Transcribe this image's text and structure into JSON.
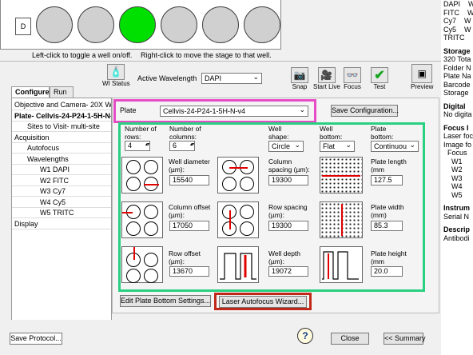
{
  "plate_preview": {
    "row_label": "D",
    "left_hint": "Left-click to toggle a well on/off.",
    "right_hint": "Right-click to move the stage to that well."
  },
  "right_pane": {
    "lines": [
      {
        "text": "DAPI    W",
        "bold": false
      },
      {
        "text": "FITC    W",
        "bold": false
      },
      {
        "text": "Cy7    W",
        "bold": false
      },
      {
        "text": "Cy5    W",
        "bold": false
      },
      {
        "text": "TRITC",
        "bold": false
      },
      {
        "text": "Storage",
        "bold": true
      },
      {
        "text": "320 Tota",
        "bold": false
      },
      {
        "text": "Folder N",
        "bold": false
      },
      {
        "text": "Plate Na",
        "bold": false
      },
      {
        "text": "Barcode",
        "bold": false
      },
      {
        "text": "Storage",
        "bold": false
      },
      {
        "text": "Digital",
        "bold": true
      },
      {
        "text": "No digita",
        "bold": false
      },
      {
        "text": "Focus I",
        "bold": true
      },
      {
        "text": "Laser foc",
        "bold": false
      },
      {
        "text": "Image fo",
        "bold": false
      },
      {
        "text": "  Focus",
        "bold": false
      },
      {
        "text": "    W1",
        "bold": false
      },
      {
        "text": "    W2",
        "bold": false
      },
      {
        "text": "    W3",
        "bold": false
      },
      {
        "text": "    W4",
        "bold": false
      },
      {
        "text": "    W5",
        "bold": false
      },
      {
        "text": "Instrum",
        "bold": true
      },
      {
        "text": "Serial N",
        "bold": false
      },
      {
        "text": "Descrip",
        "bold": true
      },
      {
        "text": "Antibodi",
        "bold": false
      }
    ]
  },
  "toolbar": {
    "wi_status": "WI Status",
    "active_wavelength_label": "Active Wavelength",
    "active_wavelength_value": "DAPI",
    "snap": "Snap",
    "start_live": "Start Live",
    "focus": "Focus",
    "test": "Test",
    "preview": "Preview"
  },
  "tabs": [
    "Configure",
    "Run"
  ],
  "tree": [
    {
      "label": "Objective and Camera- 20X Wa",
      "indent": 0,
      "bold": false
    },
    {
      "label": "Plate- Cellvis-24-P24-1-5H-N-",
      "indent": 0,
      "bold": true
    },
    {
      "label": "Sites to Visit- multi-site",
      "indent": 1,
      "bold": false
    },
    {
      "label": "Acquisition",
      "indent": 0,
      "bold": false
    },
    {
      "label": "Autofocus",
      "indent": 1,
      "bold": false
    },
    {
      "label": "Wavelengths",
      "indent": 1,
      "bold": false
    },
    {
      "label": "W1 DAPI",
      "indent": 2,
      "bold": false
    },
    {
      "label": "W2 FITC",
      "indent": 2,
      "bold": false
    },
    {
      "label": "W3 Cy7",
      "indent": 2,
      "bold": false
    },
    {
      "label": "W4 Cy5",
      "indent": 2,
      "bold": false
    },
    {
      "label": "W5 TRITC",
      "indent": 2,
      "bold": false
    },
    {
      "label": "Display",
      "indent": 0,
      "bold": false
    }
  ],
  "plate": {
    "label": "Plate",
    "selected": "Cellvis-24-P24-1-5H-N-v4",
    "save_config": "Save Configuration..."
  },
  "fields": {
    "rows_label": "Number of rows:",
    "rows_value": "4",
    "cols_label": "Number of columns:",
    "cols_value": "6",
    "well_shape_label": "Well shape:",
    "well_shape_value": "Circle",
    "well_bottom_label": "Well bottom:",
    "well_bottom_value": "Flat",
    "plate_bottom_label": "Plate bottom:",
    "plate_bottom_value": "Continuou",
    "well_diameter_label": "Well diameter (µm):",
    "well_diameter_value": "15540",
    "col_spacing_label": "Column spacing (µm):",
    "col_spacing_value": "19300",
    "plate_length_label": "Plate length (mm",
    "plate_length_value": "127.5",
    "col_offset_label": "Column offset (µm):",
    "col_offset_value": "17050",
    "row_spacing_label": "Row spacing (µm):",
    "row_spacing_value": "19300",
    "plate_width_label": "Plate width (mm)",
    "plate_width_value": "85.3",
    "row_offset_label": "Row offset (µm):",
    "row_offset_value": "13670",
    "well_depth_label": "Well depth (µm):",
    "well_depth_value": "19072",
    "plate_height_label": "Plate height (mm",
    "plate_height_value": "20.0"
  },
  "buttons": {
    "edit_plate_bottom": "Edit Plate Bottom Settings...",
    "laser_af_wizard": "Laser Autofocus Wizard...",
    "save_protocol": "Save Protocol...",
    "close": "Close",
    "summary": "<< Summary"
  },
  "colors": {
    "well_active": "#00e000",
    "highlight_pink": "#e64cc6",
    "highlight_green": "#2ad081",
    "highlight_red": "#c0291a",
    "diagram_red": "#e00000"
  }
}
